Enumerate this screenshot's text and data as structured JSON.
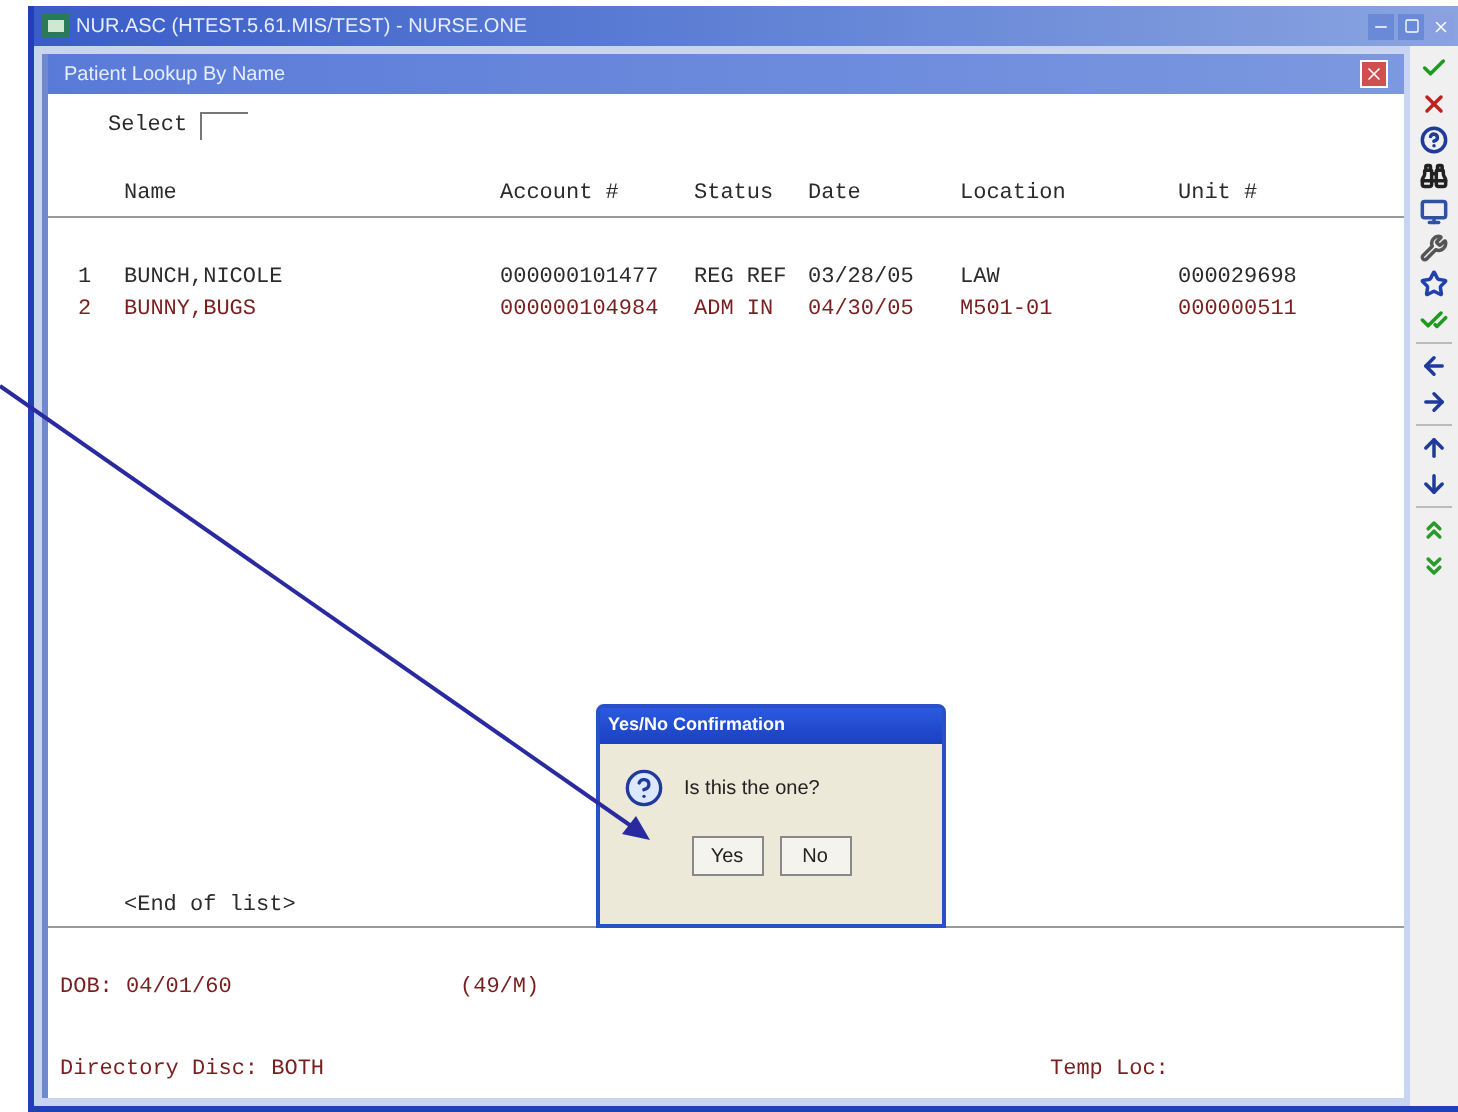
{
  "window": {
    "title": "NUR.ASC (HTEST.5.61.MIS/TEST) - NURSE.ONE"
  },
  "lookup": {
    "title": "Patient Lookup By Name",
    "select_label": "Select",
    "columns": [
      "Name",
      "Account #",
      "Status",
      "Date",
      "Location",
      "Unit #"
    ],
    "rows": [
      {
        "number": "1",
        "cells": [
          "BUNCH,NICOLE",
          "000000101477",
          "REG REF",
          "03/28/05",
          "LAW",
          "000029698"
        ],
        "color": "#2b2b2b"
      },
      {
        "number": "2",
        "cells": [
          "BUNNY,BUGS",
          "000000104984",
          "ADM IN",
          "04/30/05",
          "M501-01",
          "000000511"
        ],
        "color": "#7a1f1f"
      }
    ],
    "end_text": "<End of list>",
    "dob": "DOB: 04/01/60",
    "age_sex": "(49/M)",
    "directory": "Directory Disc: BOTH",
    "temp_loc": "Temp Loc:"
  },
  "dialog": {
    "title": "Yes/No Confirmation",
    "message": "Is this the one?",
    "buttons": [
      "Yes",
      "No"
    ]
  }
}
